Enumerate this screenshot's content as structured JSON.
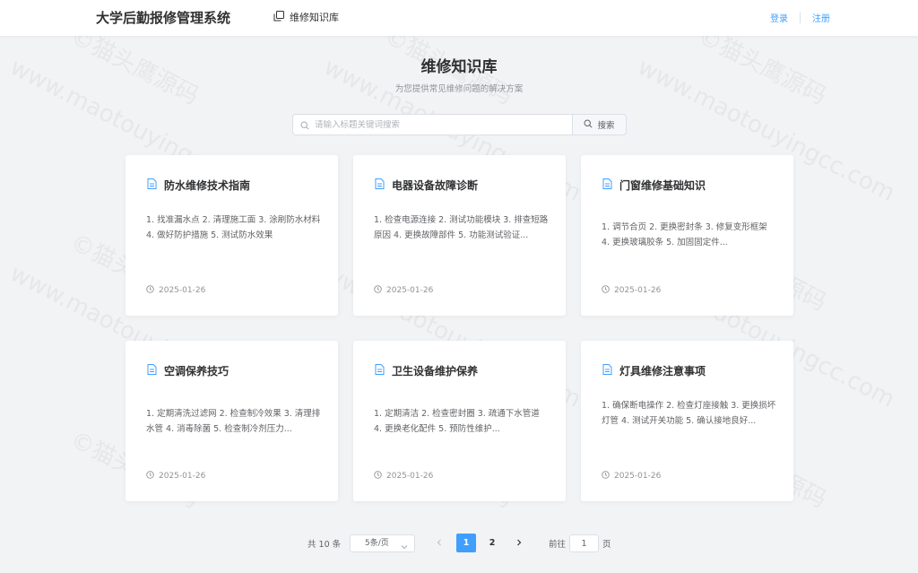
{
  "header": {
    "brand": "大学后勤报修管理系统",
    "nav_label": "维修知识库",
    "login": "登录",
    "register": "注册"
  },
  "page": {
    "title": "维修知识库",
    "subtitle": "为您提供常见维修问题的解决方案"
  },
  "search": {
    "placeholder": "请输入标题关键词搜索",
    "value": "",
    "button_label": "搜索"
  },
  "cards": [
    {
      "title": "防水维修技术指南",
      "desc": "1. 找准漏水点 2. 清理施工面 3. 涂刷防水材料 4. 做好防护措施 5. 测试防水效果",
      "date": "2025-01-26"
    },
    {
      "title": "电器设备故障诊断",
      "desc": "1. 检查电源连接 2. 测试功能模块 3. 排查短路原因 4. 更换故障部件 5. 功能测试验证...",
      "date": "2025-01-26"
    },
    {
      "title": "门窗维修基础知识",
      "desc": "1. 调节合页 2. 更换密封条 3. 修复变形框架 4. 更换玻璃胶条 5. 加固固定件...",
      "date": "2025-01-26"
    },
    {
      "title": "空调保养技巧",
      "desc": "1. 定期清洗过滤网 2. 检查制冷效果 3. 清理排水管 4. 消毒除菌 5. 检查制冷剂压力...",
      "date": "2025-01-26"
    },
    {
      "title": "卫生设备维护保养",
      "desc": "1. 定期清洁 2. 检查密封圈 3. 疏通下水管道 4. 更换老化配件 5. 预防性维护...",
      "date": "2025-01-26"
    },
    {
      "title": "灯具维修注意事项",
      "desc": "1. 确保断电操作 2. 检查灯座接触 3. 更换损坏灯管 4. 测试开关功能 5. 确认接地良好...",
      "date": "2025-01-26"
    }
  ],
  "pagination": {
    "total": "共 10 条",
    "page_size": "5条/页",
    "pages": [
      "1",
      "2"
    ],
    "current": "1",
    "goto_label": "前往",
    "goto_value": "1",
    "page_suffix": "页"
  },
  "watermark": "©猫头鹰源码 www.maotouyingcc.com",
  "colors": {
    "accent": "#409eff",
    "background": "#f2f3f5",
    "card": "#ffffff",
    "icon": "#409eff"
  }
}
